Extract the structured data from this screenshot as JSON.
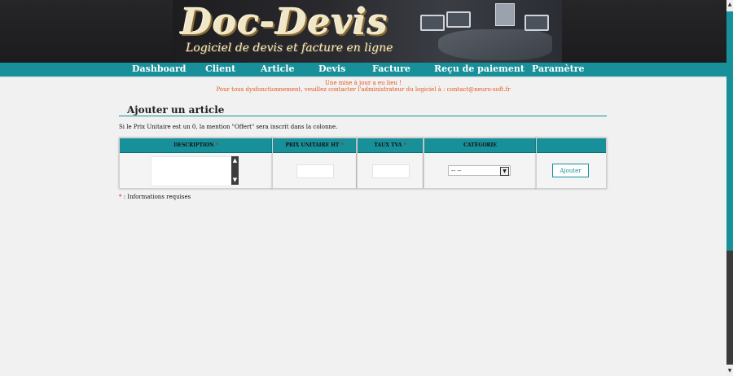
{
  "header": {
    "logo_title": "Doc-Devis",
    "logo_subtitle": "Logiciel de devis et facture en ligne"
  },
  "nav": {
    "items": [
      {
        "label": "Dashboard"
      },
      {
        "label": "Client"
      },
      {
        "label": "Article"
      },
      {
        "label": "Devis"
      },
      {
        "label": "Facture"
      },
      {
        "label": "Reçu de paiement"
      },
      {
        "label": "Paramètre"
      }
    ]
  },
  "notices": {
    "line1": "Une mise à jour a eu lieu !",
    "line2": "Pour tous dysfonctionnement, veuillez contacter l'administrateur du logiciel à : contact@neuro-soft.fr"
  },
  "section": {
    "title": "Ajouter un article",
    "info": "Si le Prix Unitaire est un 0, la mention \"Offert\" sera inscrit dans la colonne."
  },
  "table": {
    "columns": [
      {
        "label": "DESCRIPTION",
        "required": "*"
      },
      {
        "label": "PRIX UNITAIRE HT",
        "required": "*"
      },
      {
        "label": "TAUX TVA",
        "required": "*"
      },
      {
        "label": "CATÉGORIE",
        "required": ""
      },
      {
        "label": "",
        "required": ""
      }
    ],
    "description_value": "",
    "prix_value": "",
    "tva_value": "",
    "category_selected": "-- --",
    "add_button": "Ajouter"
  },
  "footer_note": {
    "asterisk": "*",
    "text": " : Informations requises"
  },
  "colors": {
    "accent": "#17909a",
    "notice": "#e8541c",
    "required": "#dd1111"
  },
  "icons": {
    "scroll_up": "chevron-up-icon",
    "scroll_down": "chevron-down-icon",
    "select_arrow": "chevron-down-icon"
  }
}
